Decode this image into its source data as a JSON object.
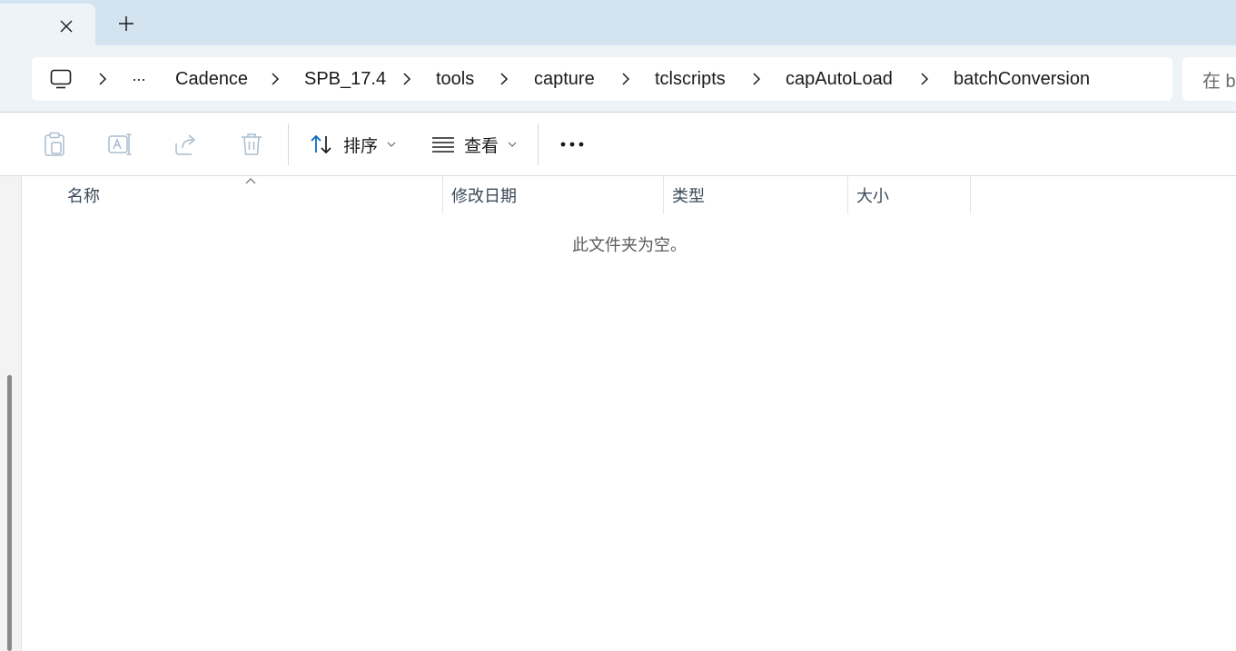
{
  "tab": {
    "close_icon": "close-icon",
    "new_tab_icon": "plus-icon"
  },
  "breadcrumb": {
    "device_icon": "monitor-icon",
    "overflow": "···",
    "items": [
      "Cadence",
      "SPB_17.4",
      "tools",
      "capture",
      "tclscripts",
      "capAutoLoad",
      "batchConversion"
    ]
  },
  "search": {
    "placeholder": "在 b"
  },
  "toolbar": {
    "paste_icon": "paste-icon",
    "rename_icon": "rename-icon",
    "share_icon": "share-icon",
    "delete_icon": "trash-icon",
    "sort_label": "排序",
    "view_label": "查看",
    "more_icon": "more-icon"
  },
  "columns": {
    "name": "名称",
    "modified": "修改日期",
    "type": "类型",
    "size": "大小"
  },
  "empty_message": "此文件夹为空。",
  "colors": {
    "titlebar": "#d3e3f0",
    "addressbar": "#eef3f8",
    "accent": "#0067c0",
    "disabled_icon": "#a9bccf"
  }
}
